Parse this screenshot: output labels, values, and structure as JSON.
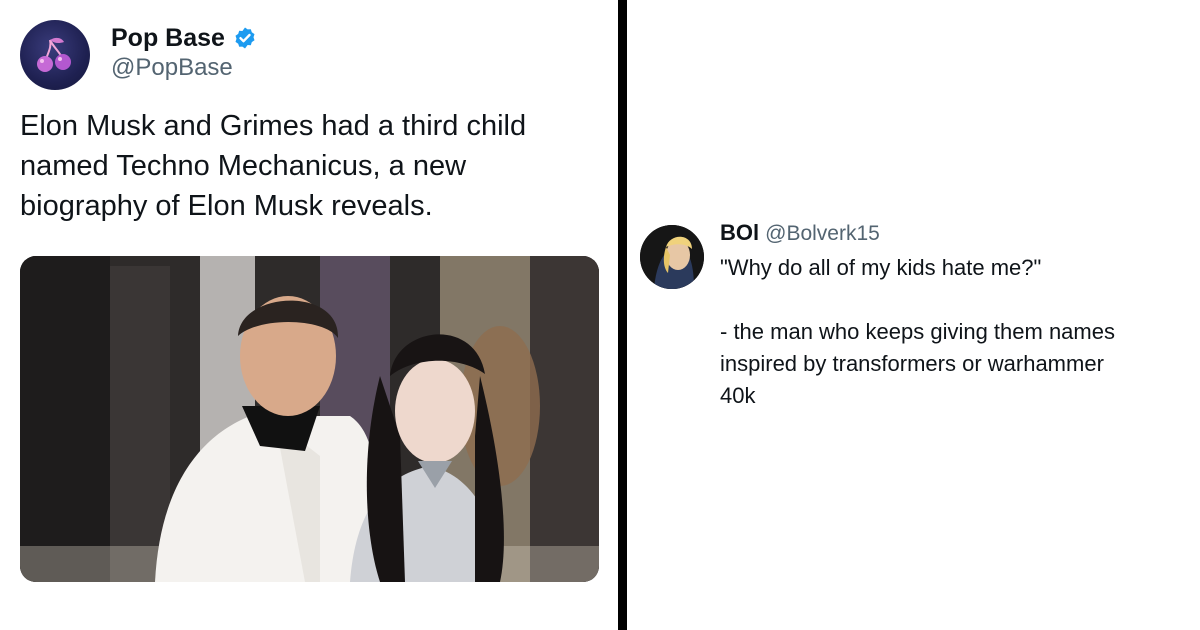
{
  "left_tweet": {
    "author_name": "Pop Base",
    "author_handle": "@PopBase",
    "avatar_icon": "cherries-icon",
    "verified_icon": "verified-badge-icon",
    "verified_color": "#1d9bf0",
    "text_lines": [
      "Elon Musk and Grimes had a third child",
      "named Techno Mechanicus, a new",
      "biography of Elon Musk reveals."
    ],
    "media": {
      "type": "photo",
      "subject": "man in white tuxedo and woman with dark hair at a gala"
    }
  },
  "right_tweet": {
    "author_name": "BOl",
    "author_handle": "@Bolverk15",
    "avatar_icon": "cartoon-avatar",
    "text_lines": [
      "\"Why do all of my kids hate me?\"",
      "",
      "- the man who keeps giving them names",
      "inspired by transformers or warhammer",
      "40k"
    ]
  },
  "colors": {
    "text_primary": "#0f1419",
    "text_secondary": "#536471",
    "divider": "#000000"
  }
}
